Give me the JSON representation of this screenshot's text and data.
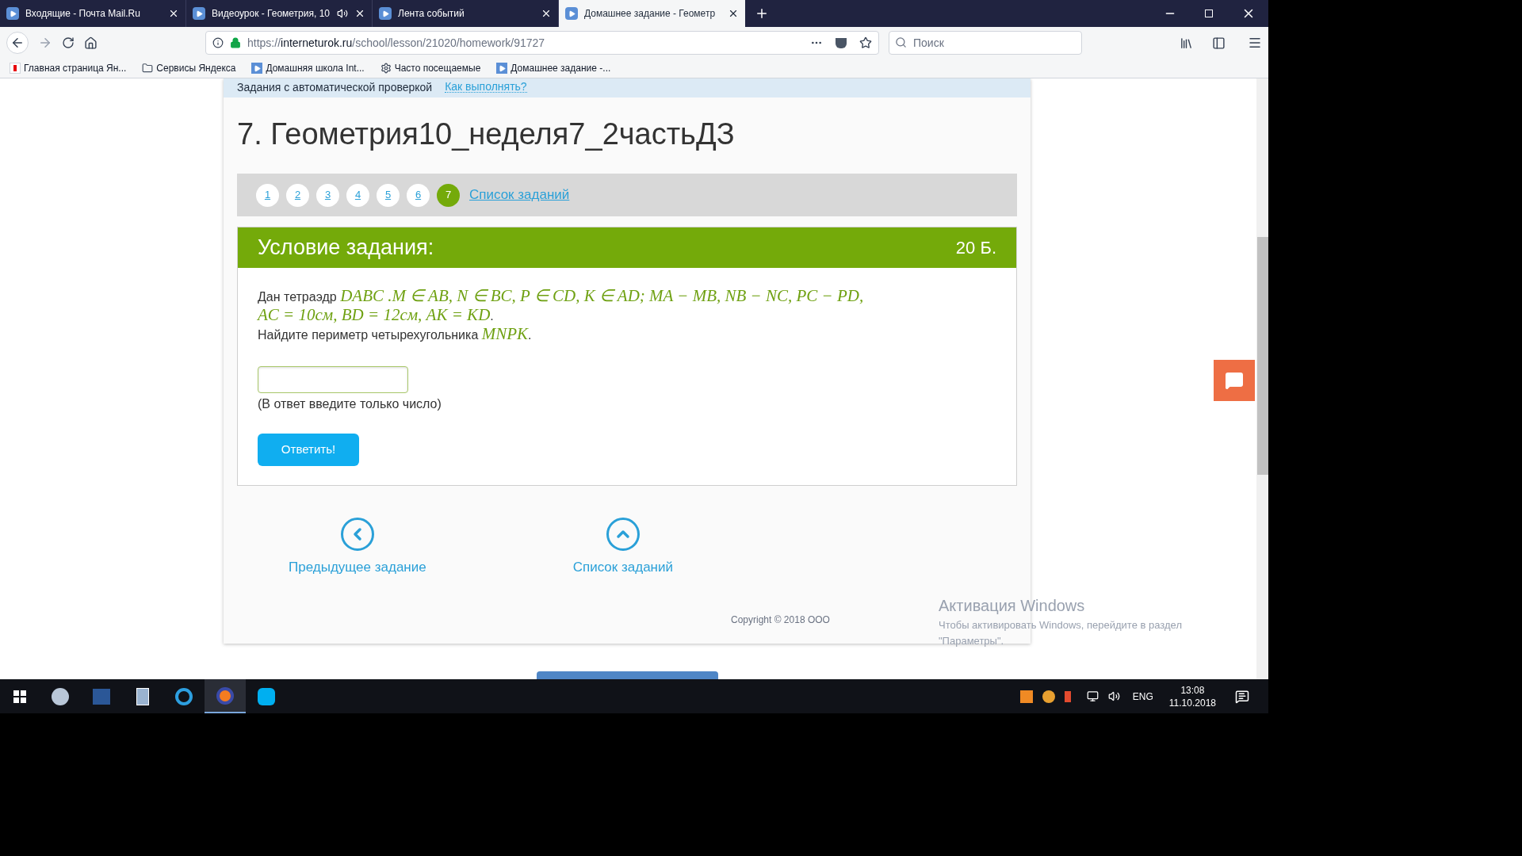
{
  "browser": {
    "tabs": [
      {
        "label": "Входящие - Почта Mail.Ru",
        "selected": false,
        "audio": false
      },
      {
        "label": "Видеоурок - Геометрия, 10",
        "selected": false,
        "audio": true
      },
      {
        "label": "Лента событий",
        "selected": false,
        "audio": false
      },
      {
        "label": "Домашнее задание - Геометр",
        "selected": true,
        "audio": false
      }
    ],
    "url": {
      "scheme": "https://",
      "host": "interneturok.ru",
      "path": "/school/lesson/21020/homework/91727"
    },
    "search": {
      "placeholder": "Поиск"
    },
    "bookmarks": [
      {
        "kind": "yandex",
        "label": "Главная страница Ян..."
      },
      {
        "kind": "folder",
        "label": "Сервисы Яндекса"
      },
      {
        "kind": "page",
        "label": "Домашняя школа Int..."
      },
      {
        "kind": "gear",
        "label": "Часто посещаемые"
      },
      {
        "kind": "page",
        "label": "Домашнее задание -..."
      }
    ]
  },
  "page": {
    "banner": {
      "text": "Задания с автоматической проверкой",
      "link": "Как выполнять?"
    },
    "title": "7. Геометрия10_неделя7_2частьДЗ",
    "pager": {
      "items": [
        {
          "label": "1",
          "selected": false
        },
        {
          "label": "2",
          "selected": false
        },
        {
          "label": "3",
          "selected": false
        },
        {
          "label": "4",
          "selected": false
        },
        {
          "label": "5",
          "selected": false
        },
        {
          "label": "6",
          "selected": false
        },
        {
          "label": "7",
          "selected": true
        }
      ],
      "link": "Список заданий"
    },
    "task": {
      "header": "Условие задания:",
      "points": "20 Б.",
      "paragraphs": [
        [
          {
            "kind": "text",
            "text": "Дан тетраэдр "
          },
          {
            "kind": "math",
            "text": "DABC .M ∈ AB, N ∈ BC, P ∈ CD, K ∈ AD; MA − MB, NB − NC, PC − PD,"
          }
        ],
        [
          {
            "kind": "math",
            "text": "AC = 10см, BD = 12см, AK = KD"
          },
          {
            "kind": "text",
            "text": "."
          }
        ],
        [
          {
            "kind": "text",
            "text": "Найдите периметр четырехугольника "
          },
          {
            "kind": "math",
            "text": "MNPK"
          },
          {
            "kind": "text",
            "text": "."
          }
        ]
      ],
      "hint": "(В ответ введите только число)",
      "submit": "Ответить!"
    },
    "nav": [
      {
        "kind": "prev",
        "label": "Предыдущее задание"
      },
      {
        "kind": "list",
        "label": "Список заданий"
      }
    ],
    "copyright": "Copyright © 2018 ООО"
  },
  "activation": {
    "title": "Активация Windows",
    "text": "Чтобы активировать Windows, перейдите в раздел \"Параметры\"."
  },
  "taskbar": {
    "lang": "ENG",
    "time": "13:08",
    "date": "11.10.2018"
  }
}
